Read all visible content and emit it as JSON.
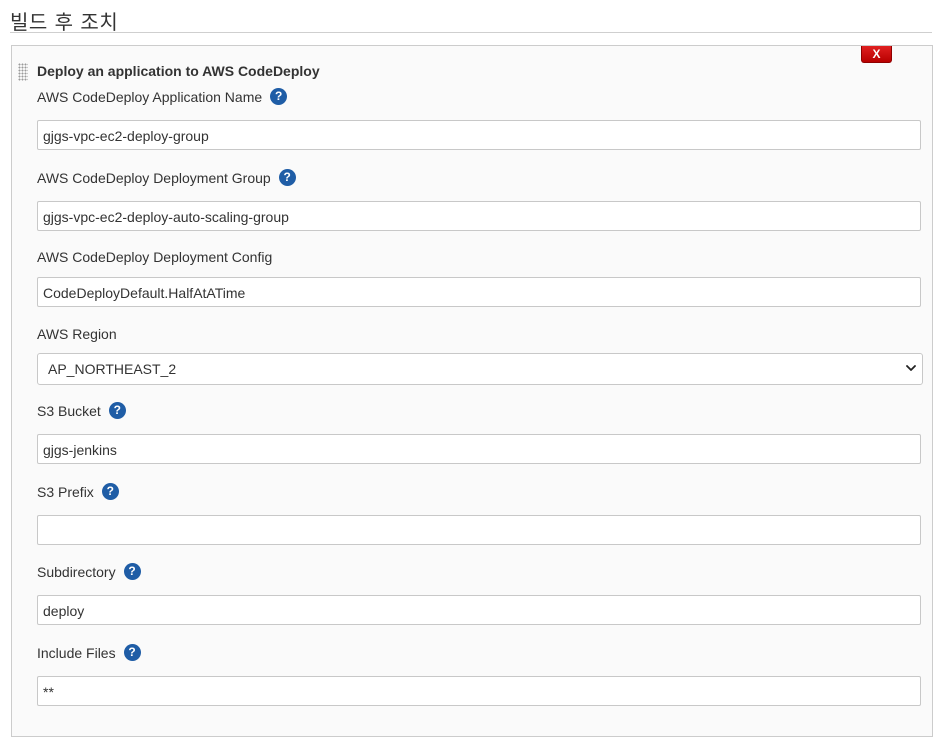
{
  "section": {
    "title": "빌드 후 조치"
  },
  "panel": {
    "title": "Deploy an application to AWS CodeDeploy",
    "delete_label": "X",
    "help_symbol": "?"
  },
  "fields": {
    "application_name": {
      "label": "AWS CodeDeploy Application Name",
      "value": "gjgs-vpc-ec2-deploy-group"
    },
    "deployment_group": {
      "label": "AWS CodeDeploy Deployment Group",
      "value": "gjgs-vpc-ec2-deploy-auto-scaling-group"
    },
    "deployment_config": {
      "label": "AWS CodeDeploy Deployment Config",
      "value": "CodeDeployDefault.HalfAtATime"
    },
    "region": {
      "label": "AWS Region",
      "value": "AP_NORTHEAST_2"
    },
    "s3_bucket": {
      "label": "S3 Bucket",
      "value": "gjgs-jenkins"
    },
    "s3_prefix": {
      "label": "S3 Prefix",
      "value": ""
    },
    "subdirectory": {
      "label": "Subdirectory",
      "value": "deploy"
    },
    "include_files": {
      "label": "Include Files",
      "value": "**"
    }
  },
  "colors": {
    "delete_button": "#cc0000",
    "help_icon": "#1f5da6",
    "panel_background": "#fafafa",
    "border": "#c8c8c8"
  }
}
